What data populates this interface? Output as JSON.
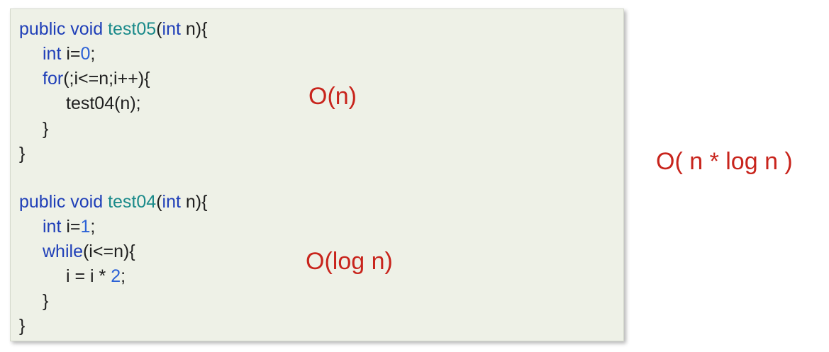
{
  "code": {
    "test05": {
      "line1": {
        "kw1": "public void ",
        "fn": "test05",
        "p1": "(",
        "kw2": "int",
        "p2": " n){"
      },
      "line2": {
        "kw": "int",
        "p1": " i=",
        "num": "0",
        "p2": ";"
      },
      "line3": {
        "kw": "for",
        "p1": "(;i<=n;i++){"
      },
      "line4": {
        "text": "test04(n);"
      },
      "line5": {
        "text": "}"
      },
      "line6": {
        "text": "}"
      }
    },
    "test04": {
      "line1": {
        "kw1": "public void ",
        "fn": "test04",
        "p1": "(",
        "kw2": "int",
        "p2": " n){"
      },
      "line2": {
        "kw": "int",
        "p1": " i=",
        "num": "1",
        "p2": ";"
      },
      "line3": {
        "kw": "while",
        "p1": "(i<=n){"
      },
      "line4": {
        "p1": "i = i * ",
        "num": "2",
        "p2": ";"
      },
      "line5": {
        "text": "}"
      },
      "line6": {
        "text": "}"
      }
    }
  },
  "annotations": {
    "outer": "O(n)",
    "inner": "O(log n)",
    "total": "O( n * log n )"
  },
  "colors": {
    "keyword": "#1f3fb8",
    "function_name": "#1a8a8a",
    "number": "#2b61d6",
    "complexity": "#c8241c",
    "panel_background": "#eef1e7"
  }
}
